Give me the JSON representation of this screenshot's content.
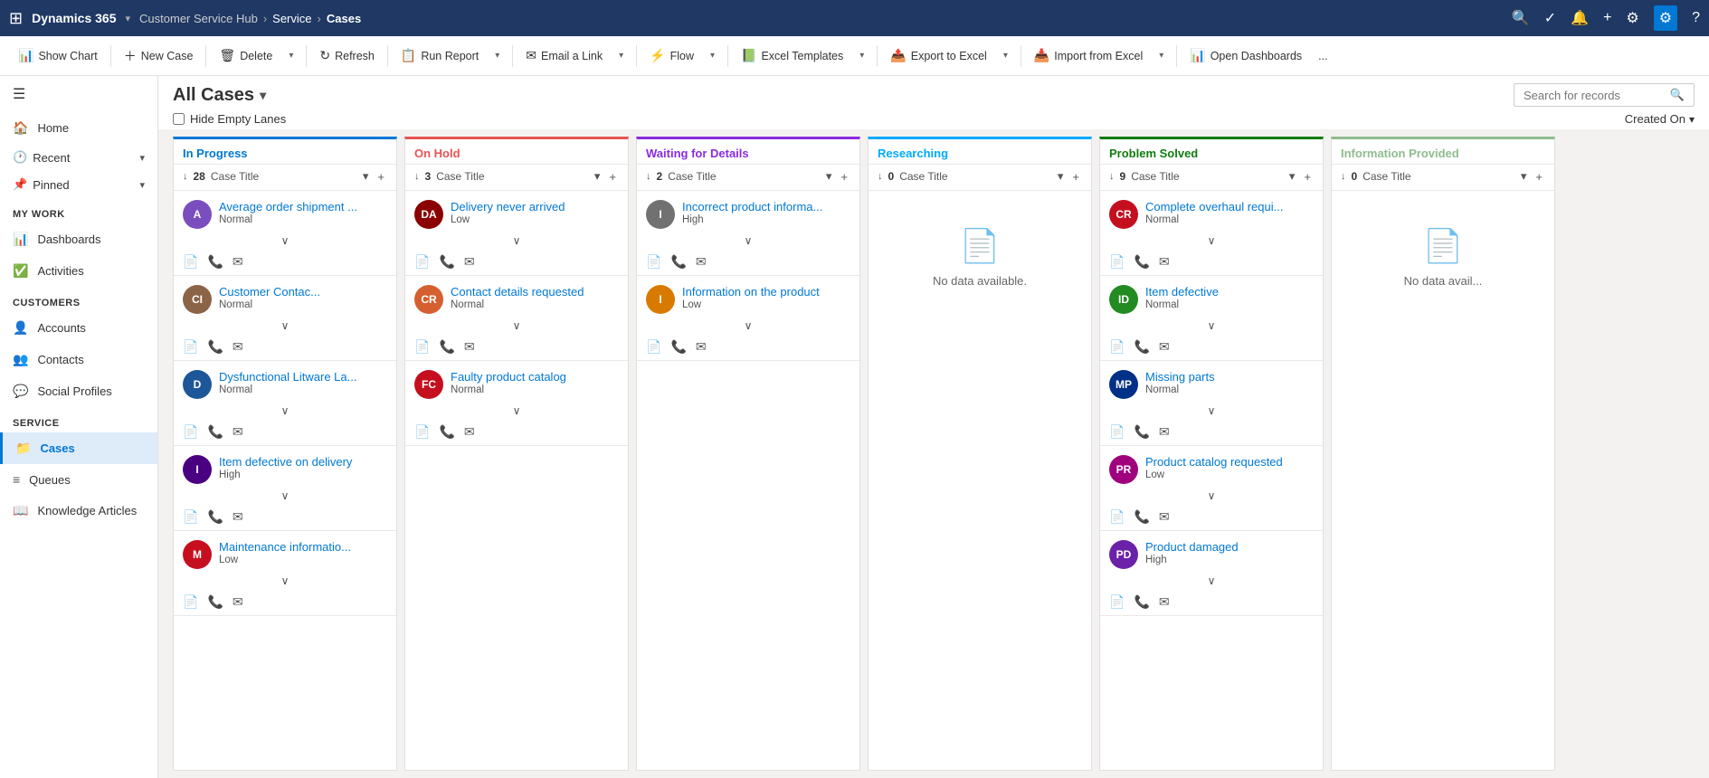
{
  "topnav": {
    "app_name": "Dynamics 365",
    "breadcrumb": [
      "Service",
      "Cases"
    ],
    "icons": [
      "search",
      "circle-check",
      "bell",
      "plus",
      "filter",
      "settings",
      "help"
    ]
  },
  "toolbar": {
    "show_chart": "Show Chart",
    "new_case": "New Case",
    "delete": "Delete",
    "refresh": "Refresh",
    "run_report": "Run Report",
    "email_link": "Email a Link",
    "flow": "Flow",
    "excel_templates": "Excel Templates",
    "export_to_excel": "Export to Excel",
    "import_from_excel": "Import from Excel",
    "open_dashboards": "Open Dashboards",
    "more": "..."
  },
  "header": {
    "title": "All Cases",
    "search_placeholder": "Search for records",
    "hide_empty_lanes": "Hide Empty Lanes",
    "created_on": "Created On"
  },
  "sidebar": {
    "hamburger": "☰",
    "home": "Home",
    "recent": "Recent",
    "pinned": "Pinned",
    "my_work_label": "My Work",
    "dashboards": "Dashboards",
    "activities": "Activities",
    "customers_label": "Customers",
    "accounts": "Accounts",
    "contacts": "Contacts",
    "social_profiles": "Social Profiles",
    "service_label": "Service",
    "cases": "Cases",
    "queues": "Queues",
    "knowledge_articles": "Knowledge Articles"
  },
  "columns": [
    {
      "id": "in-progress",
      "label": "In Progress",
      "color_class": "in-progress",
      "count": 28,
      "cards": [
        {
          "initials": "A",
          "color": "av-purple",
          "title": "Average order shipment ...",
          "priority": "Normal"
        },
        {
          "initials": "CI",
          "color": "av-brown",
          "title": "Customer Contac...",
          "priority": "Normal"
        },
        {
          "initials": "D",
          "color": "av-dark-blue",
          "title": "Dysfunctional Litware La...",
          "priority": "Normal"
        },
        {
          "initials": "I",
          "color": "av-indigo",
          "title": "Item defective on delivery",
          "priority": "High"
        },
        {
          "initials": "M",
          "color": "av-crimson",
          "title": "Maintenance informatio...",
          "priority": "Low"
        }
      ],
      "no_data": false
    },
    {
      "id": "on-hold",
      "label": "On Hold",
      "color_class": "on-hold",
      "count": 3,
      "cards": [
        {
          "initials": "DA",
          "color": "av-dark-red",
          "title": "Delivery never arrived",
          "priority": "Low"
        },
        {
          "initials": "CR",
          "color": "av-orange-red",
          "title": "Contact details requested",
          "priority": "Normal"
        },
        {
          "initials": "FC",
          "color": "av-red",
          "title": "Faulty product catalog",
          "priority": "Normal"
        }
      ],
      "no_data": false
    },
    {
      "id": "waiting",
      "label": "Waiting for Details",
      "color_class": "waiting",
      "count": 2,
      "cards": [
        {
          "initials": "I",
          "color": "av-gray",
          "title": "Incorrect product informa...",
          "priority": "High"
        },
        {
          "initials": "I",
          "color": "av-orange",
          "title": "Information on the product",
          "priority": "Low"
        }
      ],
      "no_data": false
    },
    {
      "id": "researching",
      "label": "Researching",
      "color_class": "researching",
      "count": 0,
      "cards": [],
      "no_data": true,
      "no_data_text": "No data available."
    },
    {
      "id": "problem-solved",
      "label": "Problem Solved",
      "color_class": "problem-solved",
      "count": 9,
      "cards": [
        {
          "initials": "CR",
          "color": "av-red",
          "title": "Complete overhaul requi...",
          "priority": "Normal"
        },
        {
          "initials": "ID",
          "color": "av-forest",
          "title": "Item defective",
          "priority": "Normal"
        },
        {
          "initials": "MP",
          "color": "av-navy",
          "title": "Missing parts",
          "priority": "Normal"
        },
        {
          "initials": "PR",
          "color": "av-magenta",
          "title": "Product catalog requested",
          "priority": "Low"
        },
        {
          "initials": "PD",
          "color": "av-dark-purple",
          "title": "Product damaged",
          "priority": "High"
        }
      ],
      "no_data": false
    },
    {
      "id": "info-provided",
      "label": "Information Provided",
      "color_class": "info-provided",
      "count": 0,
      "cards": [],
      "no_data": true,
      "no_data_text": "No data avail..."
    }
  ],
  "context_menu": {
    "visible": true,
    "items": []
  }
}
